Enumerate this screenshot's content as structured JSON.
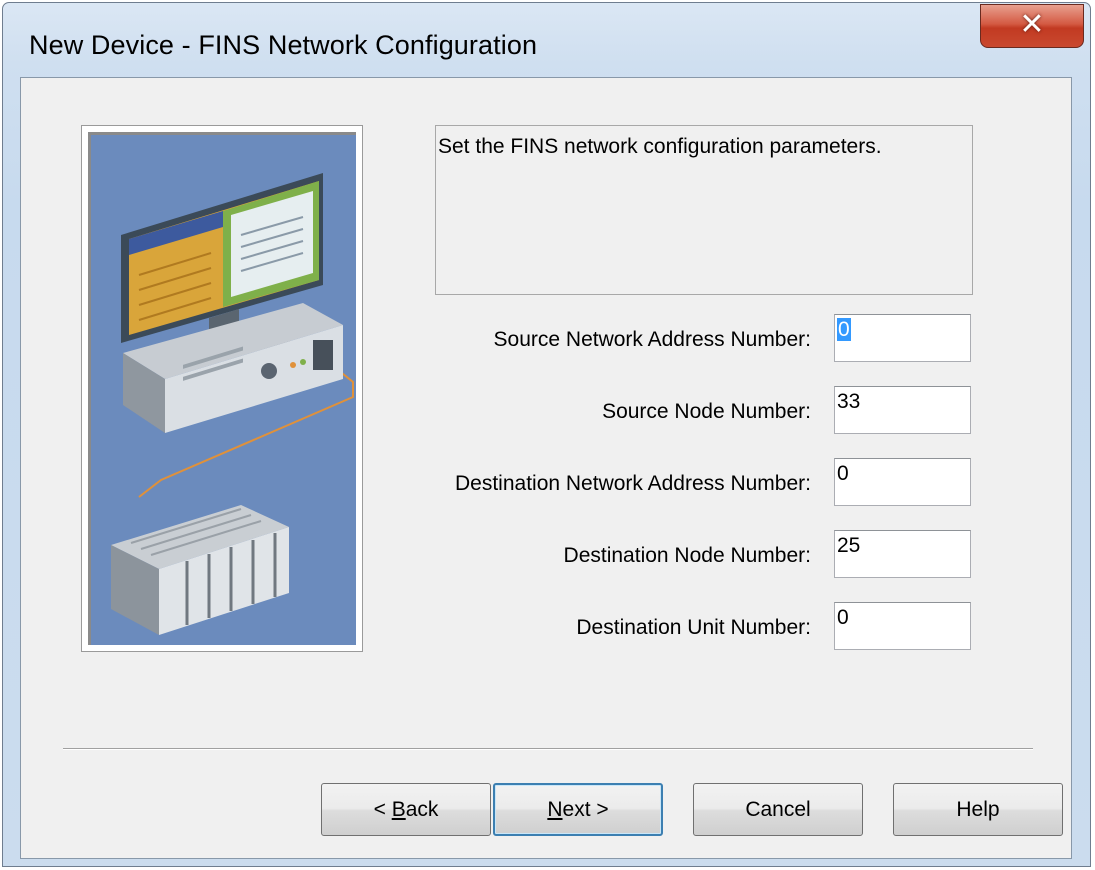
{
  "window": {
    "title": "New Device - FINS Network Configuration",
    "close_glyph": "✕"
  },
  "description": "Set the FINS network configuration parameters.",
  "fields": [
    {
      "label": "Source Network Address Number:",
      "value": "0",
      "selected": true
    },
    {
      "label": "Source Node Number:",
      "value": "33"
    },
    {
      "label": "Destination Network Address Number:",
      "value": "0"
    },
    {
      "label": "Destination Node Number:",
      "value": "25"
    },
    {
      "label": "Destination Unit Number:",
      "value": "0"
    }
  ],
  "buttons": {
    "back": {
      "mnemonic": "B",
      "before": "< ",
      "after": "ack"
    },
    "next": {
      "mnemonic": "N",
      "before": "",
      "after": "ext >"
    },
    "cancel": "Cancel",
    "help": "Help"
  },
  "colors": {
    "illustration_bg": "#6b8bbd",
    "selection": "#3399ff",
    "close_button": "#c9492f"
  },
  "icons": [
    "close-icon",
    "computer-network-illustration"
  ]
}
